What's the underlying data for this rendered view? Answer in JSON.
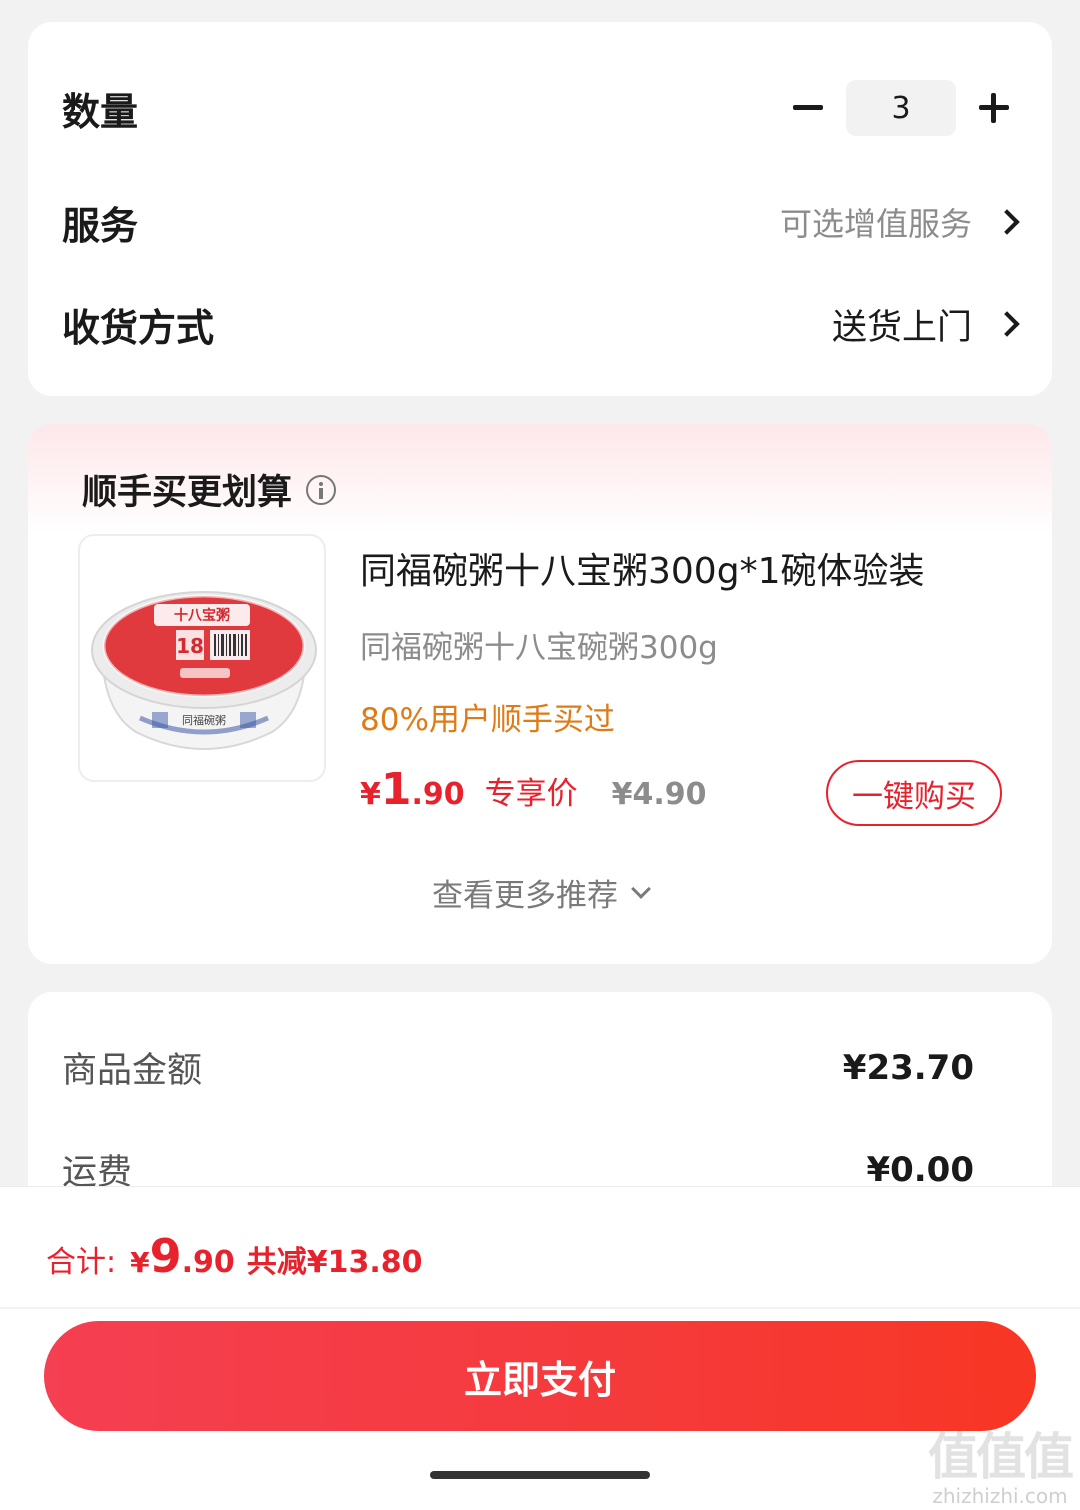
{
  "options": {
    "quantity": {
      "label": "数量",
      "value": "3"
    },
    "service": {
      "label": "服务",
      "value": "可选增值服务"
    },
    "delivery": {
      "label": "收货方式",
      "value": "送货上门"
    }
  },
  "recommendation": {
    "title": "顺手买更划算",
    "product": {
      "name": "同福碗粥十八宝粥300g*1碗体验装",
      "subtitle": "同福碗粥十八宝碗粥300g",
      "hint": "80%用户顺手买过",
      "price_yen": "¥",
      "price_int": "1",
      "price_dec": ".90",
      "price_tag": "专享价",
      "original_price": "¥4.90",
      "buy_label": "一键购买",
      "image_label_top": "十八宝粥",
      "image_label_num": "18",
      "image_brand": "同福碗粥"
    },
    "more_label": "查看更多推荐"
  },
  "summary": {
    "goods_label": "商品金额",
    "goods_value": "¥23.70",
    "shipping_label": "运费",
    "shipping_value": "¥0.00"
  },
  "bottom": {
    "total_label": "合计:",
    "total_yen": "¥",
    "total_int": "9",
    "total_dec": ".90",
    "saved": "共减¥13.80",
    "pay_label": "立即支付"
  },
  "watermark": {
    "big": "值值值",
    "small": "zhizhizhi.com"
  },
  "colors": {
    "accent": "#e8222d",
    "hint": "#e07a14",
    "muted": "#8c8c8c"
  }
}
